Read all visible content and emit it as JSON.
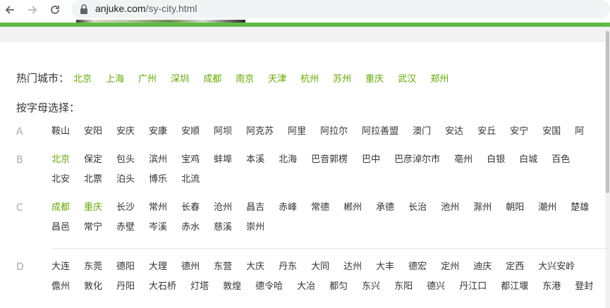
{
  "browser": {
    "url_domain": "anjuke.com",
    "url_path": "/sy-city.html"
  },
  "hot": {
    "label": "热门城市：",
    "cities": [
      "北京",
      "上海",
      "广州",
      "深圳",
      "成都",
      "南京",
      "天津",
      "杭州",
      "苏州",
      "重庆",
      "武汉",
      "郑州"
    ]
  },
  "alpha": {
    "title": "按字母选择：",
    "groups": [
      {
        "letter": "A",
        "lines": [
          [
            "鞍山",
            "安阳",
            "安庆",
            "安康",
            "安顺",
            "阿坝",
            "阿克苏",
            "阿里",
            "阿拉尔",
            "阿拉善盟",
            "澳门",
            "安达",
            "安丘",
            "安宁",
            "安国",
            "阿"
          ]
        ]
      },
      {
        "letter": "B",
        "lines": [
          [
            "北京",
            "保定",
            "包头",
            "滨州",
            "宝鸡",
            "蚌埠",
            "本溪",
            "北海",
            "巴音郭楞",
            "巴中",
            "巴彦淖尔市",
            "亳州",
            "白银",
            "白城",
            "百色"
          ],
          [
            "北安",
            "北票",
            "泊头",
            "博乐",
            "北流"
          ]
        ]
      },
      {
        "letter": "C",
        "lines": [
          [
            "成都",
            "重庆",
            "长沙",
            "常州",
            "长春",
            "沧州",
            "昌吉",
            "赤峰",
            "常德",
            "郴州",
            "承德",
            "长治",
            "池州",
            "滁州",
            "朝阳",
            "潮州",
            "楚雄"
          ],
          [
            "昌邑",
            "常宁",
            "赤壁",
            "岑溪",
            "赤水",
            "慈溪",
            "崇州"
          ]
        ]
      },
      {
        "letter": "D",
        "lines": [
          [
            "大连",
            "东莞",
            "德阳",
            "大理",
            "德州",
            "东营",
            "大庆",
            "丹东",
            "大同",
            "达州",
            "大丰",
            "德宏",
            "定州",
            "迪庆",
            "定西",
            "大兴安岭"
          ],
          [
            "儋州",
            "敦化",
            "丹阳",
            "大石桥",
            "灯塔",
            "敦煌",
            "德令哈",
            "大冶",
            "都匀",
            "东兴",
            "东阳",
            "德兴",
            "丹江口",
            "都江堰",
            "东港",
            "登封"
          ]
        ]
      }
    ],
    "highlighted": [
      "北京",
      "成都",
      "重庆"
    ]
  }
}
